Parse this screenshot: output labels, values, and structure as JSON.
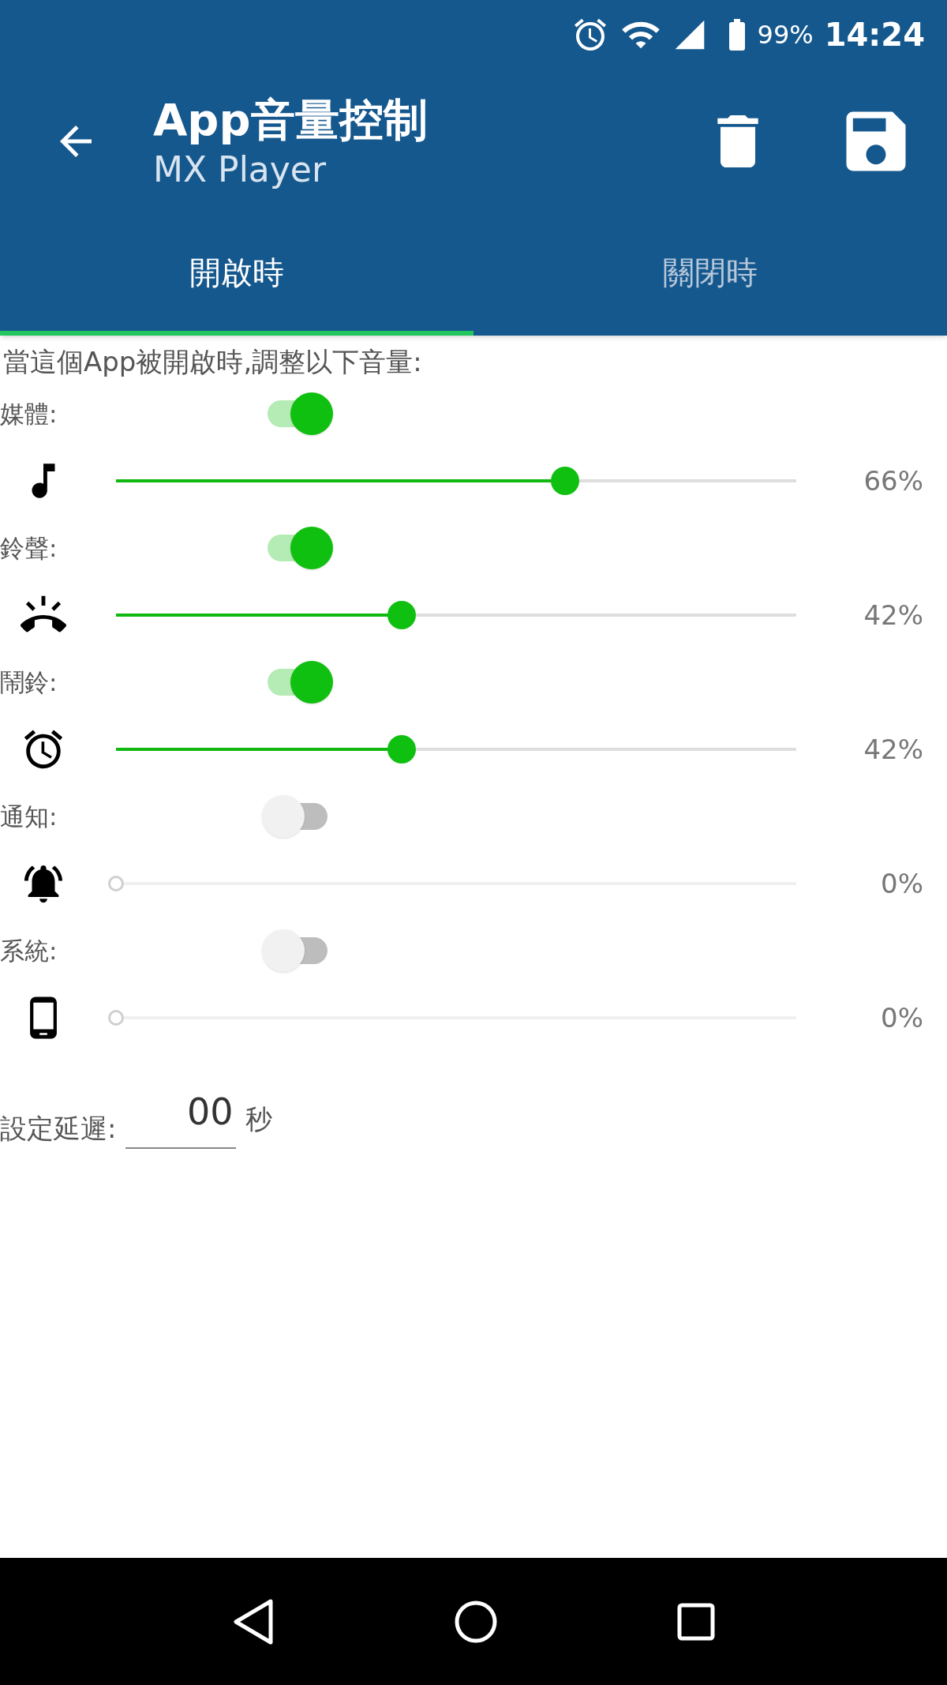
{
  "status_bar": {
    "battery": "99%",
    "time": "14:24"
  },
  "app_bar": {
    "title": "App音量控制",
    "subtitle": "MX Player"
  },
  "tabs": [
    {
      "label": "開啟時",
      "selected": true
    },
    {
      "label": "關閉時",
      "selected": false
    }
  ],
  "description": "當這個App被開啟時,調整以下音量:",
  "channels": [
    {
      "label": "媒體:",
      "kind": "music",
      "on": true,
      "level": 0.66,
      "reading": "66%"
    },
    {
      "label": "鈴聲:",
      "kind": "ring",
      "on": true,
      "level": 0.42,
      "reading": "42%"
    },
    {
      "label": "鬧鈴:",
      "kind": "alarm",
      "on": true,
      "level": 0.42,
      "reading": "42%"
    },
    {
      "label": "通知:",
      "kind": "notification",
      "on": false,
      "level": 0,
      "reading": "0%"
    },
    {
      "label": "系統:",
      "kind": "system",
      "on": false,
      "level": 0,
      "reading": "0%"
    }
  ],
  "delay": {
    "label": "設定延遲:",
    "value": "00",
    "unit": "秒"
  }
}
